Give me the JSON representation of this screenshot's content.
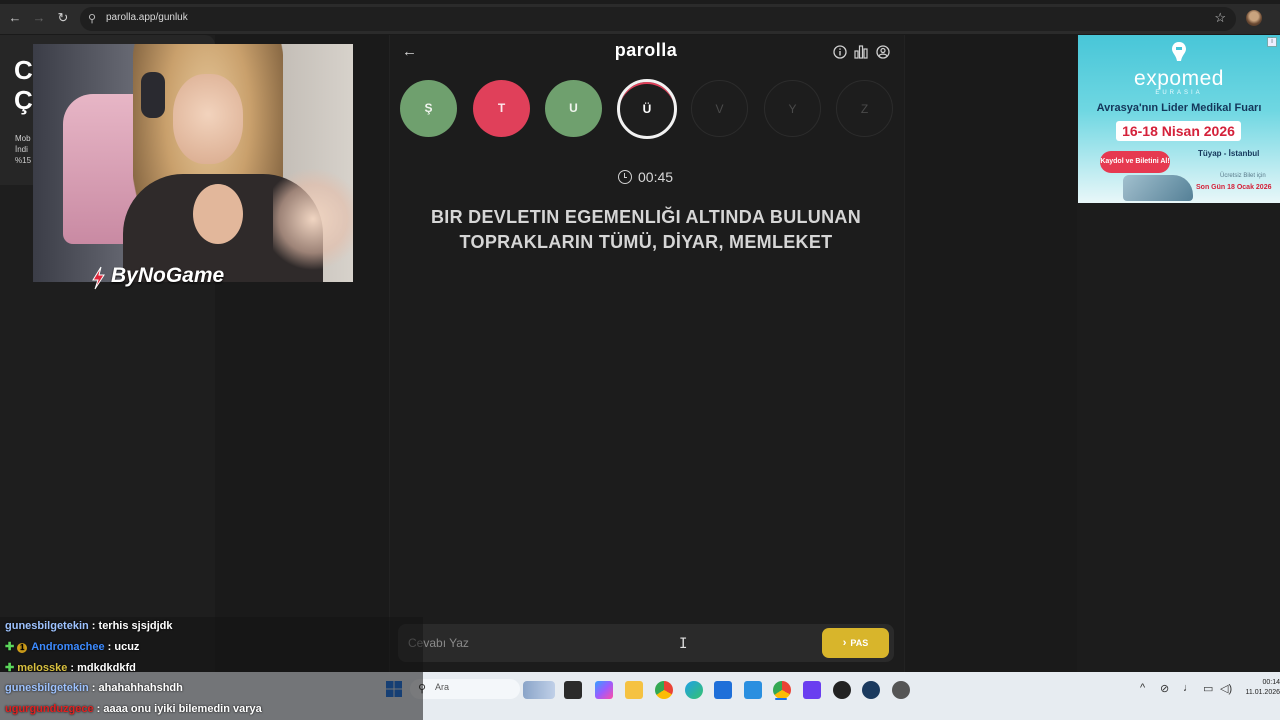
{
  "browser": {
    "url": "parolla.app/gunluk"
  },
  "left_panel": {
    "big_letters": "C\nÇ",
    "small_text": "Mob\nİndi\n%15"
  },
  "overlay": {
    "watermark": "ByNoGame"
  },
  "game": {
    "title": "parolla",
    "letters": [
      {
        "char": "Ş",
        "state": "correct"
      },
      {
        "char": "T",
        "state": "wrong"
      },
      {
        "char": "U",
        "state": "correct"
      },
      {
        "char": "Ü",
        "state": "current"
      },
      {
        "char": "V",
        "state": "pending"
      },
      {
        "char": "Y",
        "state": "pending"
      },
      {
        "char": "Z",
        "state": "pending"
      }
    ],
    "timer": "00:45",
    "question": "BIR DEVLETIN EGEMENLIĞI ALTINDA BULUNAN TOPRAKLARIN TÜMÜ, DİYAR, MEMLEKET",
    "answer_placeholder": "Cevabı Yaz",
    "pass_label": "PAS",
    "colors": {
      "correct": "#6fa06e",
      "wrong": "#e0405a",
      "pass": "#d8b52b"
    }
  },
  "ad": {
    "brand": "expomed",
    "brand_sub": "EURASIA",
    "tagline": "Avrasya'nın Lider Medikal Fuarı",
    "dates": "16-18 Nisan 2026",
    "cta": "Kaydol ve Biletini Al!",
    "venue": "Tüyap - İstanbul",
    "note1": "Ücretsiz Bilet için",
    "note2": "Son Gün 18 Ocak 2026"
  },
  "chat": [
    {
      "user": "gunesbilgetekin",
      "msg": "terhis sjsjdjdk",
      "color": "#9ec3ff",
      "badges": ""
    },
    {
      "user": "Andromachee",
      "msg": "ucuz",
      "color": "#3d8bff",
      "badges": "plus-one"
    },
    {
      "user": "melosske",
      "msg": "mdkdkdkfd",
      "color": "#d8c040",
      "badges": "plus"
    },
    {
      "user": "gunesbilgetekin",
      "msg": "ahahahhahshdh",
      "color": "#9ec3ff",
      "badges": ""
    },
    {
      "user": "ugurgunduzgece",
      "msg": "aaaa onu iyiki bilemedin varya",
      "color": "#e02020",
      "badges": ""
    }
  ],
  "taskbar": {
    "search_placeholder": "Ara",
    "time": "00:14",
    "date": "11.01.2026"
  }
}
